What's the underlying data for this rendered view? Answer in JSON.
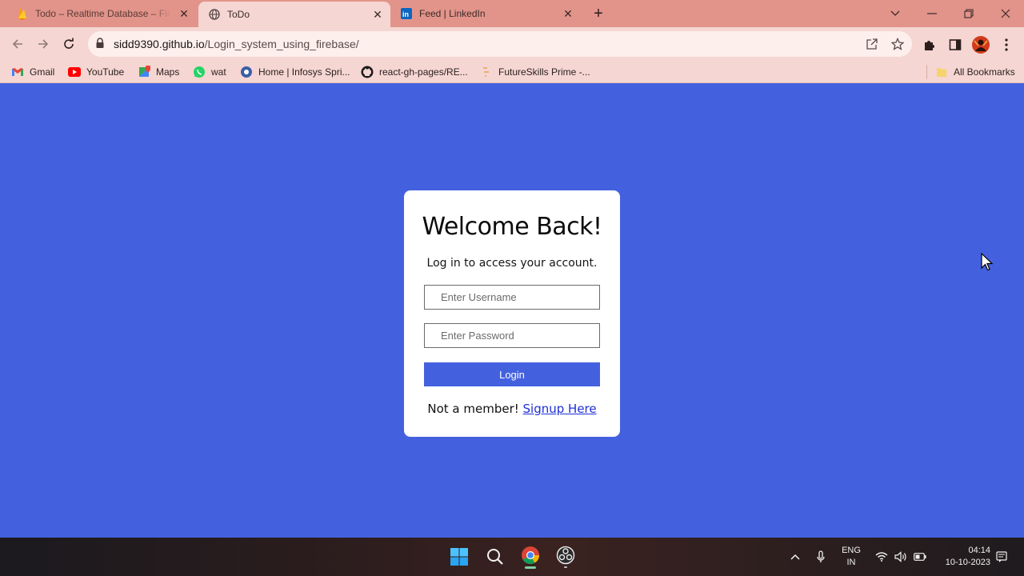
{
  "browser": {
    "tabs": [
      {
        "title": "Todo – Realtime Database – Firebase",
        "icon": "firebase-icon",
        "active": false
      },
      {
        "title": "ToDo",
        "icon": "globe-icon",
        "active": true
      },
      {
        "title": "Feed | LinkedIn",
        "icon": "linkedin-icon",
        "active": false
      }
    ],
    "url_host": "sidd9390.github.io",
    "url_path": "/Login_system_using_firebase/",
    "bookmarks": [
      {
        "label": "Gmail",
        "icon": "gmail-icon"
      },
      {
        "label": "YouTube",
        "icon": "youtube-icon"
      },
      {
        "label": "Maps",
        "icon": "maps-icon"
      },
      {
        "label": "wat",
        "icon": "whatsapp-icon"
      },
      {
        "label": "Home | Infosys Spri...",
        "icon": "infosys-icon"
      },
      {
        "label": "react-gh-pages/RE...",
        "icon": "github-icon"
      },
      {
        "label": "FutureSkills Prime -...",
        "icon": "futureskills-icon"
      }
    ],
    "all_bookmarks": "All Bookmarks"
  },
  "login": {
    "title": "Welcome Back!",
    "subtitle": "Log in to access your account.",
    "username_placeholder": "Enter Username",
    "password_placeholder": "Enter Password",
    "login_label": "Login",
    "not_member": "Not a member!",
    "signup_link": "Signup Here"
  },
  "colors": {
    "page_background": "#4361df",
    "button": "#4361df",
    "tabbar": "#e2948a",
    "toolbar": "#f5d6d2"
  },
  "taskbar": {
    "language_line1": "ENG",
    "language_line2": "IN",
    "time": "04:14",
    "date": "10-10-2023"
  }
}
